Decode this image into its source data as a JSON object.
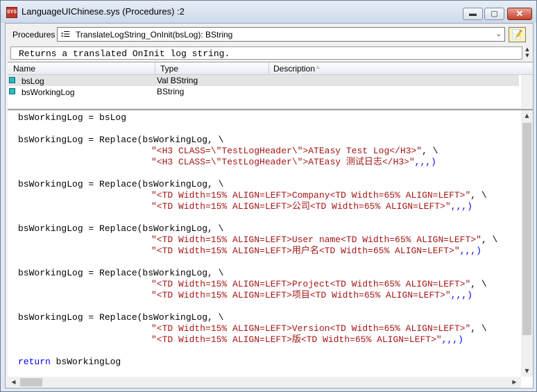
{
  "window": {
    "icon_label": "SYS",
    "title": "LanguageUIChinese.sys (Procedures) :2",
    "min_glyph": "▬",
    "max_glyph": "▢",
    "close_glyph": "✕"
  },
  "procedures": {
    "label": "Procedures :",
    "value": "TranslateLogString_OnInit(bsLog): BString",
    "icon": "function-icon",
    "notes_icon": "notes-icon"
  },
  "description": {
    "text": "Returns a translated OnInit log string."
  },
  "grid": {
    "headers": {
      "name": "Name",
      "type": "Type",
      "description": "Description"
    },
    "rows": [
      {
        "name": "bsLog",
        "type": "Val BString"
      },
      {
        "name": "bsWorkingLog",
        "type": "BString"
      }
    ]
  },
  "code": {
    "l1": "bsWorkingLog = bsLog",
    "b1_head": "bsWorkingLog = Replace(bsWorkingLog, \\",
    "b1_a": "\"<H3 CLASS=\\\"TestLogHeader\\\">ATEasy Test Log</H3>\"",
    "b1_a_tail": ", \\",
    "b1_b": "\"<H3 CLASS=\\\"TestLogHeader\\\">ATEasy 测试日志</H3>\"",
    "b1_b_tail": ",,,)",
    "b2_head": "bsWorkingLog = Replace(bsWorkingLog, \\",
    "b2_a": "\"<TD Width=15% ALIGN=LEFT>Company<TD Width=65% ALIGN=LEFT>\"",
    "b2_a_tail": ", \\",
    "b2_b": "\"<TD Width=15% ALIGN=LEFT>公司<TD Width=65% ALIGN=LEFT>\"",
    "b2_b_tail": ",,,)",
    "b3_head": "bsWorkingLog = Replace(bsWorkingLog, \\",
    "b3_a": "\"<TD Width=15% ALIGN=LEFT>User name<TD Width=65% ALIGN=LEFT>\"",
    "b3_a_tail": ", \\",
    "b3_b": "\"<TD Width=15% ALIGN=LEFT>用户名<TD Width=65% ALIGN=LEFT>\"",
    "b3_b_tail": ",,,)",
    "b4_head": "bsWorkingLog = Replace(bsWorkingLog, \\",
    "b4_a": "\"<TD Width=15% ALIGN=LEFT>Project<TD Width=65% ALIGN=LEFT>\"",
    "b4_a_tail": ", \\",
    "b4_b": "\"<TD Width=15% ALIGN=LEFT>项目<TD Width=65% ALIGN=LEFT>\"",
    "b4_b_tail": ",,,)",
    "b5_head": "bsWorkingLog = Replace(bsWorkingLog, \\",
    "b5_a": "\"<TD Width=15% ALIGN=LEFT>Version<TD Width=65% ALIGN=LEFT>\"",
    "b5_a_tail": ", \\",
    "b5_b": "\"<TD Width=15% ALIGN=LEFT>版<TD Width=65% ALIGN=LEFT>\"",
    "b5_b_tail": ",,,)",
    "ret_kw": "return",
    "ret_rest": " bsWorkingLog"
  },
  "colors": {
    "string": "#a31515",
    "keyword": "#0000ff",
    "window_frame": "#6b7d96"
  }
}
